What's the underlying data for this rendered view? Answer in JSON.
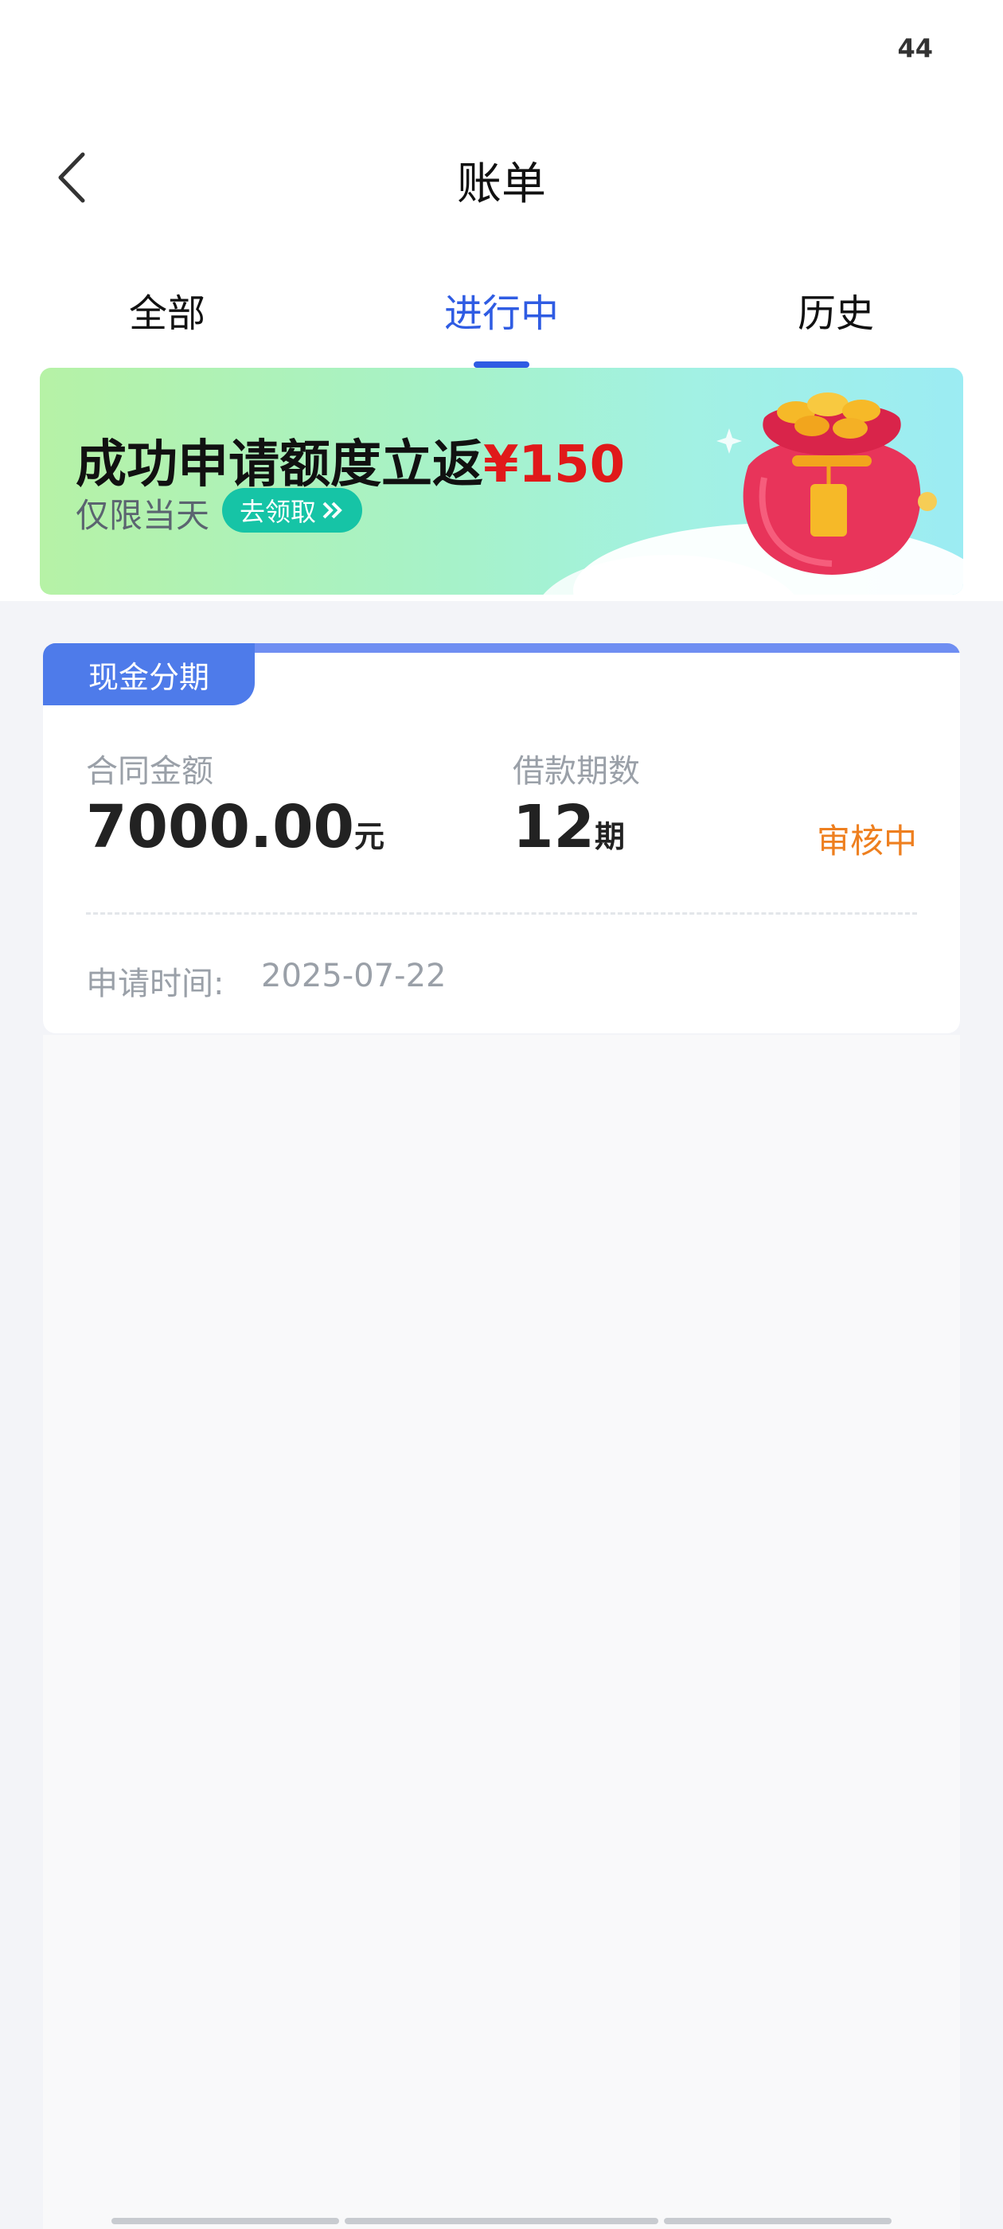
{
  "status_bar": {
    "battery": "44"
  },
  "header": {
    "title": "账单"
  },
  "tabs": [
    {
      "label": "全部",
      "active": false
    },
    {
      "label": "进行中",
      "active": true
    },
    {
      "label": "历史",
      "active": false
    }
  ],
  "banner": {
    "headline": "成功申请额度立返",
    "amount": "¥150",
    "subtitle": "仅限当天",
    "button_label": "去领取",
    "colors": {
      "amount": "#e0191a",
      "button": "#16c4a6"
    }
  },
  "bill_card": {
    "tag": "现金分期",
    "contract_amount_label": "合同金额",
    "contract_amount": "7000.00",
    "contract_amount_unit": "元",
    "periods_label": "借款期数",
    "periods": "12",
    "periods_unit": "期",
    "status": "审核中",
    "apply_time_label": "申请时间:",
    "apply_time": "2025-07-22",
    "colors": {
      "tag": "#4e7bea",
      "status": "#ee7f1f"
    }
  },
  "theme": {
    "accent": "#2f5ce3"
  }
}
